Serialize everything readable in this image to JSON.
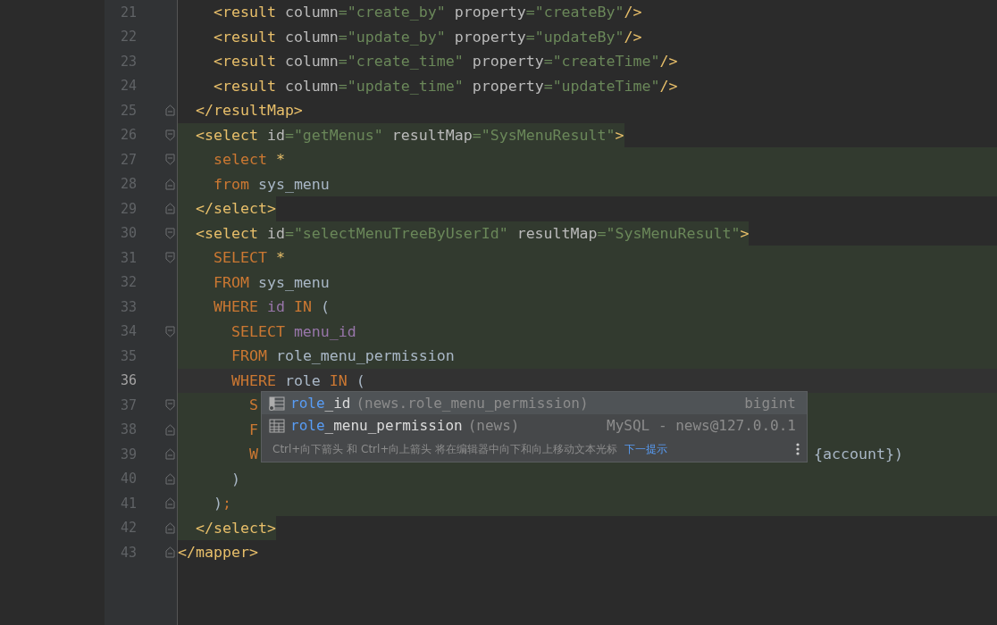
{
  "editor": {
    "lines": [
      {
        "number": "21",
        "block_highlight": false,
        "tag_highlight": false,
        "fold_start": false,
        "fold_end": false,
        "current": false,
        "tokens": [
          {
            "kind": "tag",
            "text": "    <result "
          },
          {
            "kind": "attr",
            "text": "column"
          },
          {
            "kind": "str",
            "text": "=\"create_by\" "
          },
          {
            "kind": "attr",
            "text": "property"
          },
          {
            "kind": "str",
            "text": "=\"createBy\""
          },
          {
            "kind": "tag",
            "text": "/>"
          }
        ]
      },
      {
        "number": "22",
        "block_highlight": false,
        "tag_highlight": false,
        "fold_start": false,
        "fold_end": false,
        "current": false,
        "tokens": [
          {
            "kind": "tag",
            "text": "    <result "
          },
          {
            "kind": "attr",
            "text": "column"
          },
          {
            "kind": "str",
            "text": "=\"update_by\" "
          },
          {
            "kind": "attr",
            "text": "property"
          },
          {
            "kind": "str",
            "text": "=\"updateBy\""
          },
          {
            "kind": "tag",
            "text": "/>"
          }
        ]
      },
      {
        "number": "23",
        "block_highlight": false,
        "tag_highlight": false,
        "fold_start": false,
        "fold_end": false,
        "current": false,
        "tokens": [
          {
            "kind": "tag",
            "text": "    <result "
          },
          {
            "kind": "attr",
            "text": "column"
          },
          {
            "kind": "str",
            "text": "=\"create_time\" "
          },
          {
            "kind": "attr",
            "text": "property"
          },
          {
            "kind": "str",
            "text": "=\"createTime\""
          },
          {
            "kind": "tag",
            "text": "/>"
          }
        ]
      },
      {
        "number": "24",
        "block_highlight": false,
        "tag_highlight": false,
        "fold_start": false,
        "fold_end": false,
        "current": false,
        "tokens": [
          {
            "kind": "tag",
            "text": "    <result "
          },
          {
            "kind": "attr",
            "text": "column"
          },
          {
            "kind": "str",
            "text": "=\"update_time\" "
          },
          {
            "kind": "attr",
            "text": "property"
          },
          {
            "kind": "str",
            "text": "=\"updateTime\""
          },
          {
            "kind": "tag",
            "text": "/>"
          }
        ]
      },
      {
        "number": "25",
        "block_highlight": false,
        "tag_highlight": false,
        "fold_start": false,
        "fold_end": true,
        "current": false,
        "tokens": [
          {
            "kind": "tag",
            "text": "  </resultMap>"
          }
        ]
      },
      {
        "number": "26",
        "block_highlight": false,
        "tag_highlight": true,
        "fold_start": true,
        "fold_end": false,
        "current": false,
        "tokens": [
          {
            "kind": "tag",
            "text": "  <select "
          },
          {
            "kind": "attr",
            "text": "id"
          },
          {
            "kind": "str",
            "text": "=\"getMenus\" "
          },
          {
            "kind": "attr",
            "text": "resultMap"
          },
          {
            "kind": "str",
            "text": "=\"SysMenuResult\""
          },
          {
            "kind": "tag",
            "text": ">"
          }
        ]
      },
      {
        "number": "27",
        "block_highlight": true,
        "tag_highlight": false,
        "fold_start": true,
        "fold_end": false,
        "current": false,
        "tokens": [
          {
            "kind": "kw",
            "text": "    select "
          },
          {
            "kind": "star",
            "text": "*"
          }
        ]
      },
      {
        "number": "28",
        "block_highlight": true,
        "tag_highlight": false,
        "fold_start": false,
        "fold_end": true,
        "current": false,
        "tokens": [
          {
            "kind": "kw",
            "text": "    from "
          },
          {
            "kind": "plain",
            "text": "sys_menu"
          }
        ]
      },
      {
        "number": "29",
        "block_highlight": false,
        "tag_highlight": true,
        "fold_start": false,
        "fold_end": true,
        "current": false,
        "tokens": [
          {
            "kind": "tag",
            "text": "  </select>"
          }
        ]
      },
      {
        "number": "30",
        "block_highlight": false,
        "tag_highlight": true,
        "fold_start": true,
        "fold_end": false,
        "current": false,
        "tokens": [
          {
            "kind": "tag",
            "text": "  <select "
          },
          {
            "kind": "attr",
            "text": "id"
          },
          {
            "kind": "str",
            "text": "=\"selectMenuTreeByUserId\" "
          },
          {
            "kind": "attr",
            "text": "resultMap"
          },
          {
            "kind": "str",
            "text": "=\"SysMenuResult\""
          },
          {
            "kind": "tag",
            "text": ">"
          }
        ]
      },
      {
        "number": "31",
        "block_highlight": true,
        "tag_highlight": false,
        "fold_start": true,
        "fold_end": false,
        "current": false,
        "tokens": [
          {
            "kind": "kw",
            "text": "    SELECT "
          },
          {
            "kind": "star",
            "text": "*"
          }
        ]
      },
      {
        "number": "32",
        "block_highlight": true,
        "tag_highlight": false,
        "fold_start": false,
        "fold_end": false,
        "current": false,
        "tokens": [
          {
            "kind": "kw",
            "text": "    FROM "
          },
          {
            "kind": "plain",
            "text": "sys_menu"
          }
        ]
      },
      {
        "number": "33",
        "block_highlight": true,
        "tag_highlight": false,
        "fold_start": false,
        "fold_end": false,
        "current": false,
        "tokens": [
          {
            "kind": "kw",
            "text": "    WHERE "
          },
          {
            "kind": "col",
            "text": "id "
          },
          {
            "kind": "kw",
            "text": "IN "
          },
          {
            "kind": "plain",
            "text": "("
          }
        ]
      },
      {
        "number": "34",
        "block_highlight": true,
        "tag_highlight": false,
        "fold_start": true,
        "fold_end": false,
        "current": false,
        "tokens": [
          {
            "kind": "kw",
            "text": "      SELECT "
          },
          {
            "kind": "col",
            "text": "menu_id"
          }
        ]
      },
      {
        "number": "35",
        "block_highlight": true,
        "tag_highlight": false,
        "fold_start": false,
        "fold_end": false,
        "current": false,
        "tokens": [
          {
            "kind": "kw",
            "text": "      FROM "
          },
          {
            "kind": "plain",
            "text": "role_menu_permission"
          }
        ]
      },
      {
        "number": "36",
        "block_highlight": false,
        "tag_highlight": false,
        "fold_start": false,
        "fold_end": false,
        "current": true,
        "tokens": [
          {
            "kind": "kw",
            "text": "      WHERE "
          },
          {
            "kind": "plain",
            "text": "role "
          },
          {
            "kind": "kw",
            "text": "IN "
          },
          {
            "kind": "plain",
            "text": "("
          }
        ]
      },
      {
        "number": "37",
        "block_highlight": true,
        "tag_highlight": false,
        "fold_start": true,
        "fold_end": false,
        "current": false,
        "tokens": [
          {
            "kind": "kw",
            "text": "        S"
          }
        ]
      },
      {
        "number": "38",
        "block_highlight": true,
        "tag_highlight": false,
        "fold_start": false,
        "fold_end": true,
        "current": false,
        "tokens": [
          {
            "kind": "kw",
            "text": "        F"
          }
        ]
      },
      {
        "number": "39",
        "block_highlight": true,
        "tag_highlight": false,
        "fold_start": false,
        "fold_end": true,
        "current": false,
        "tokens": [
          {
            "kind": "kw",
            "text": "        W"
          }
        ],
        "tail": [
          {
            "kind": "plain",
            "text": "{account})"
          }
        ]
      },
      {
        "number": "40",
        "block_highlight": true,
        "tag_highlight": false,
        "fold_start": false,
        "fold_end": true,
        "current": false,
        "tokens": [
          {
            "kind": "plain",
            "text": "      )"
          }
        ]
      },
      {
        "number": "41",
        "block_highlight": true,
        "tag_highlight": false,
        "fold_start": false,
        "fold_end": true,
        "current": false,
        "tokens": [
          {
            "kind": "plain",
            "text": "    )"
          },
          {
            "kind": "kw",
            "text": ";"
          }
        ]
      },
      {
        "number": "42",
        "block_highlight": false,
        "tag_highlight": true,
        "fold_start": false,
        "fold_end": true,
        "current": false,
        "tokens": [
          {
            "kind": "tag",
            "text": "  </select>"
          }
        ]
      },
      {
        "number": "43",
        "block_highlight": false,
        "tag_highlight": false,
        "fold_start": false,
        "fold_end": true,
        "current": false,
        "tokens": [
          {
            "kind": "tag",
            "text": "</mapper>"
          }
        ]
      }
    ]
  },
  "completion": {
    "items": [
      {
        "kind": "column",
        "match": "role",
        "rest": "_id",
        "detail": "(news.role_menu_permission)",
        "type": "bigint",
        "selected": true
      },
      {
        "kind": "table",
        "match": "role",
        "rest": "_menu_permission",
        "detail": "(news)",
        "type": "MySQL - news@127.0.0.1",
        "selected": false
      }
    ],
    "hint": "Ctrl+向下箭头 和 Ctrl+向上箭头 将在编辑器中向下和向上移动文本光标",
    "hint_link": "下一提示"
  }
}
